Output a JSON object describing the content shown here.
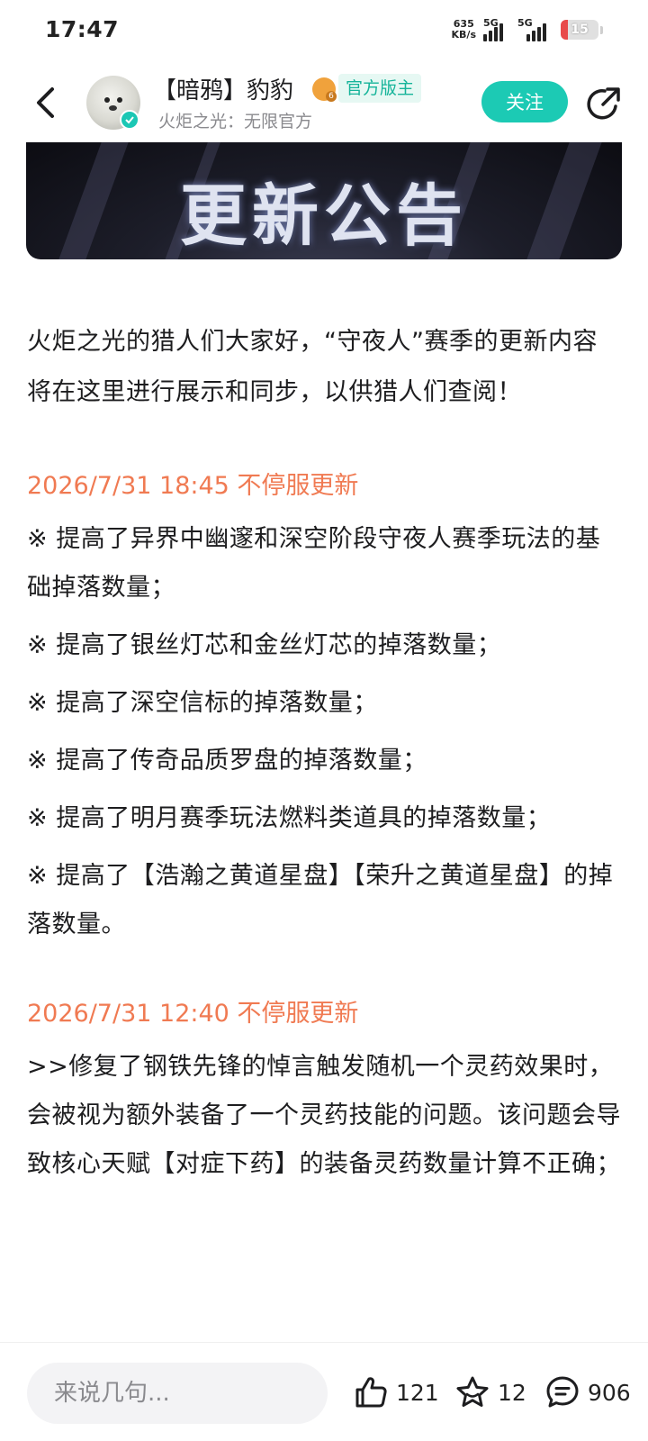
{
  "status_bar": {
    "time": "17:47",
    "net_speed_value": "635",
    "net_speed_unit": "KB/s",
    "sim1_label": "5G",
    "sim2_label": "5G",
    "battery": "15"
  },
  "header": {
    "author_name": "【暗鸦】豹豹",
    "level": "6",
    "admin_badge": "官方版主",
    "author_sub": "火炬之光：无限官方",
    "follow_label": "关注"
  },
  "banner": {
    "title": "更新公告"
  },
  "article": {
    "intro": "火炬之光的猎人们大家好，“守夜人”赛季的更新内容将在这里进行展示和同步，以供猎人们查阅！",
    "sections": [
      {
        "title": "2026/7/31 18:45 不停服更新",
        "items": [
          "※ 提高了异界中幽邃和深空阶段守夜人赛季玩法的基础掉落数量；",
          "※ 提高了银丝灯芯和金丝灯芯的掉落数量；",
          "※ 提高了深空信标的掉落数量；",
          "※ 提高了传奇品质罗盘的掉落数量；",
          "※ 提高了明月赛季玩法燃料类道具的掉落数量；",
          "※ 提高了【浩瀚之黄道星盘】【荣升之黄道星盘】的掉落数量。"
        ]
      },
      {
        "title": "2026/7/31 12:40 不停服更新",
        "items": [
          ">>修复了钢铁先锋的悼言触发随机一个灵药效果时，会被视为额外装备了一个灵药技能的问题。该问题会导致核心天赋【对症下药】的装备灵药数量计算不正确；"
        ]
      }
    ]
  },
  "bottom_bar": {
    "comment_placeholder": "来说几句...",
    "like_count": "121",
    "favorite_count": "12",
    "comment_count": "906"
  },
  "colors": {
    "accent": "#1ccab4",
    "section_title": "#f07a52",
    "text": "#1d1d1f",
    "muted": "#8a8a8e"
  },
  "icons": {
    "back": "chevron-left-icon",
    "verify": "check-icon",
    "share": "share-icon",
    "like": "thumbs-up-icon",
    "favorite": "star-icon",
    "comment": "comment-bubble-icon"
  }
}
